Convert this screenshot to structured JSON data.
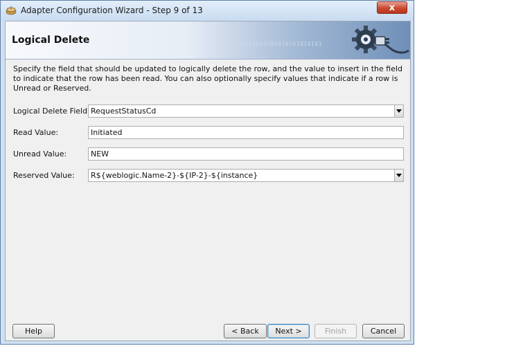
{
  "window": {
    "title": "Adapter Configuration Wizard - Step 9 of 13",
    "close_label": "x"
  },
  "banner": {
    "title": "Logical Delete",
    "binary_text": "0001010101010101010101\n010101010"
  },
  "description": "Specify the field that should be updated to logically delete the row, and the value to insert in the field to indicate that the row has been read.  You can also optionally specify values that indicate if a row is Unread or Reserved.",
  "fields": {
    "logical_delete": {
      "label": "Logical Delete Field:",
      "value": "RequestStatusCd"
    },
    "read_value": {
      "label": "Read Value:",
      "value": "Initiated"
    },
    "unread_value": {
      "label": "Unread Value:",
      "value": "NEW"
    },
    "reserved_value": {
      "label": "Reserved Value:",
      "value": "R${weblogic.Name-2}-${IP-2}-${instance}"
    }
  },
  "buttons": {
    "help": "Help",
    "back": "< Back",
    "next": "Next >",
    "finish": "Finish",
    "cancel": "Cancel"
  },
  "colors": {
    "banner_accent": "#6f8fb8",
    "close_button": "#c9482f",
    "window_frame": "#cfe0f1"
  }
}
